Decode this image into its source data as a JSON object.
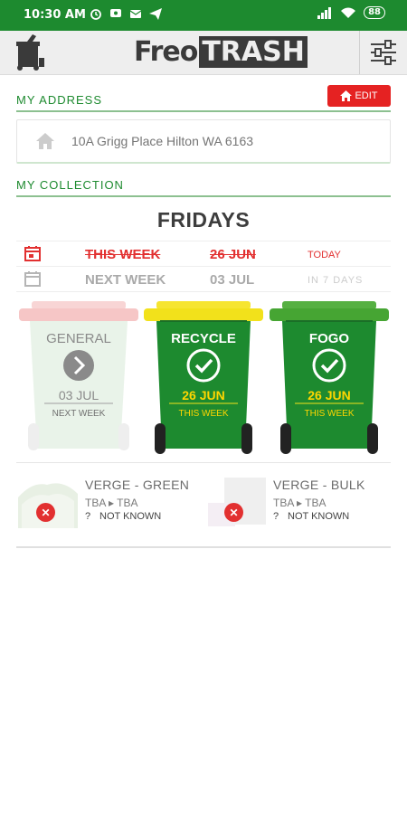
{
  "status_bar": {
    "time": "10:30 AM",
    "battery": "88"
  },
  "app": {
    "logo_part1": "Freo",
    "logo_part2": "TRASH"
  },
  "address_section": {
    "title": "MY ADDRESS",
    "edit_label": "EDIT",
    "address": "10A Grigg Place Hilton WA 6163"
  },
  "collection_section": {
    "title": "MY COLLECTION",
    "day": "FRIDAYS",
    "rows": [
      {
        "label": "THIS WEEK",
        "date": "26 JUN",
        "relative": "TODAY"
      },
      {
        "label": "NEXT WEEK",
        "date": "03 JUL",
        "relative": "IN 7 DAYS"
      }
    ],
    "bins": [
      {
        "name": "GENERAL",
        "date": "03 JUL",
        "when": "NEXT WEEK",
        "lid_color": "#f6c6c6",
        "body_color": "#e9f3e9",
        "state": "next"
      },
      {
        "name": "RECYCLE",
        "date": "26 JUN",
        "when": "THIS WEEK",
        "lid_color": "#f2e11b",
        "body_color": "#1d8a2f",
        "state": "this"
      },
      {
        "name": "FOGO",
        "date": "26 JUN",
        "when": "THIS WEEK",
        "lid_color": "#46a533",
        "body_color": "#1d8a2f",
        "state": "this"
      }
    ]
  },
  "verge": [
    {
      "title": "VERGE - GREEN",
      "dates": "TBA ▸ TBA",
      "status_icon": "?",
      "status": "NOT KNOWN"
    },
    {
      "title": "VERGE - BULK",
      "dates": "TBA ▸ TBA",
      "status_icon": "?",
      "status": "NOT KNOWN"
    }
  ],
  "colors": {
    "brand_green": "#1d8a2f",
    "alert_red": "#e52222",
    "recycle_yellow": "#f2e11b"
  }
}
